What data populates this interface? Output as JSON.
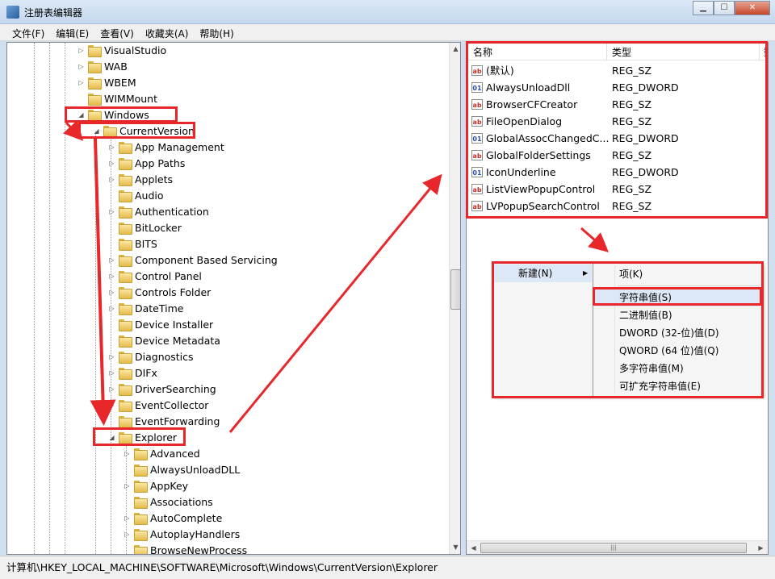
{
  "window": {
    "title": "注册表编辑器",
    "minimize": "▁",
    "maximize": "☐",
    "close": "✕"
  },
  "menu": [
    "文件(F)",
    "编辑(E)",
    "查看(V)",
    "收藏夹(A)",
    "帮助(H)"
  ],
  "tree": [
    {
      "label": "VisualStudio",
      "level": 0,
      "exp": "▷"
    },
    {
      "label": "WAB",
      "level": 0,
      "exp": "▷"
    },
    {
      "label": "WBEM",
      "level": 0,
      "exp": "▷"
    },
    {
      "label": "WIMMount",
      "level": 0,
      "exp": ""
    },
    {
      "label": "Windows",
      "level": 0,
      "exp": "◢"
    },
    {
      "label": "CurrentVersion",
      "level": 1,
      "exp": "◢"
    },
    {
      "label": "App Management",
      "level": 2,
      "exp": "▷"
    },
    {
      "label": "App Paths",
      "level": 2,
      "exp": "▷"
    },
    {
      "label": "Applets",
      "level": 2,
      "exp": "▷"
    },
    {
      "label": "Audio",
      "level": 2,
      "exp": ""
    },
    {
      "label": "Authentication",
      "level": 2,
      "exp": "▷"
    },
    {
      "label": "BitLocker",
      "level": 2,
      "exp": ""
    },
    {
      "label": "BITS",
      "level": 2,
      "exp": ""
    },
    {
      "label": "Component Based Servicing",
      "level": 2,
      "exp": "▷"
    },
    {
      "label": "Control Panel",
      "level": 2,
      "exp": "▷"
    },
    {
      "label": "Controls Folder",
      "level": 2,
      "exp": "▷"
    },
    {
      "label": "DateTime",
      "level": 2,
      "exp": "▷"
    },
    {
      "label": "Device Installer",
      "level": 2,
      "exp": ""
    },
    {
      "label": "Device Metadata",
      "level": 2,
      "exp": ""
    },
    {
      "label": "Diagnostics",
      "level": 2,
      "exp": "▷"
    },
    {
      "label": "DIFx",
      "level": 2,
      "exp": "▷"
    },
    {
      "label": "DriverSearching",
      "level": 2,
      "exp": "▷"
    },
    {
      "label": "EventCollector",
      "level": 2,
      "exp": "▷"
    },
    {
      "label": "EventForwarding",
      "level": 2,
      "exp": ""
    },
    {
      "label": "Explorer",
      "level": 2,
      "exp": "◢"
    },
    {
      "label": "Advanced",
      "level": 3,
      "exp": "▷"
    },
    {
      "label": "AlwaysUnloadDLL",
      "level": 3,
      "exp": ""
    },
    {
      "label": "AppKey",
      "level": 3,
      "exp": "▷"
    },
    {
      "label": "Associations",
      "level": 3,
      "exp": ""
    },
    {
      "label": "AutoComplete",
      "level": 3,
      "exp": "▷"
    },
    {
      "label": "AutoplayHandlers",
      "level": 3,
      "exp": "▷"
    },
    {
      "label": "BrowseNewProcess",
      "level": 3,
      "exp": ""
    }
  ],
  "list": {
    "col_name": "名称",
    "col_type": "类型",
    "col_data_cut": "数",
    "rows": [
      {
        "icon": "ab",
        "kind": "sz",
        "name": "(默认)",
        "type": "REG_SZ"
      },
      {
        "icon": "01",
        "kind": "dw",
        "name": "AlwaysUnloadDll",
        "type": "REG_DWORD"
      },
      {
        "icon": "ab",
        "kind": "sz",
        "name": "BrowserCFCreator",
        "type": "REG_SZ"
      },
      {
        "icon": "ab",
        "kind": "sz",
        "name": "FileOpenDialog",
        "type": "REG_SZ"
      },
      {
        "icon": "01",
        "kind": "dw",
        "name": "GlobalAssocChangedC...",
        "type": "REG_DWORD"
      },
      {
        "icon": "ab",
        "kind": "sz",
        "name": "GlobalFolderSettings",
        "type": "REG_SZ"
      },
      {
        "icon": "01",
        "kind": "dw",
        "name": "IconUnderline",
        "type": "REG_DWORD"
      },
      {
        "icon": "ab",
        "kind": "sz",
        "name": "ListViewPopupControl",
        "type": "REG_SZ"
      },
      {
        "icon": "ab",
        "kind": "sz",
        "name": "LVPopupSearchControl",
        "type": "REG_SZ"
      }
    ]
  },
  "context_menu": {
    "new_label": "新建(N)",
    "arrow": "▶"
  },
  "submenu": [
    "项(K)",
    "字符串值(S)",
    "二进制值(B)",
    "DWORD (32-位)值(D)",
    "QWORD (64 位)值(Q)",
    "多字符串值(M)",
    "可扩充字符串值(E)"
  ],
  "status": "计算机\\HKEY_LOCAL_MACHINE\\SOFTWARE\\Microsoft\\Windows\\CurrentVersion\\Explorer",
  "scroll": {
    "up": "▲",
    "down": "▼",
    "left": "◀",
    "right": "▶",
    "grip": "|||"
  },
  "colors": {
    "annotation": "#e8272b"
  }
}
